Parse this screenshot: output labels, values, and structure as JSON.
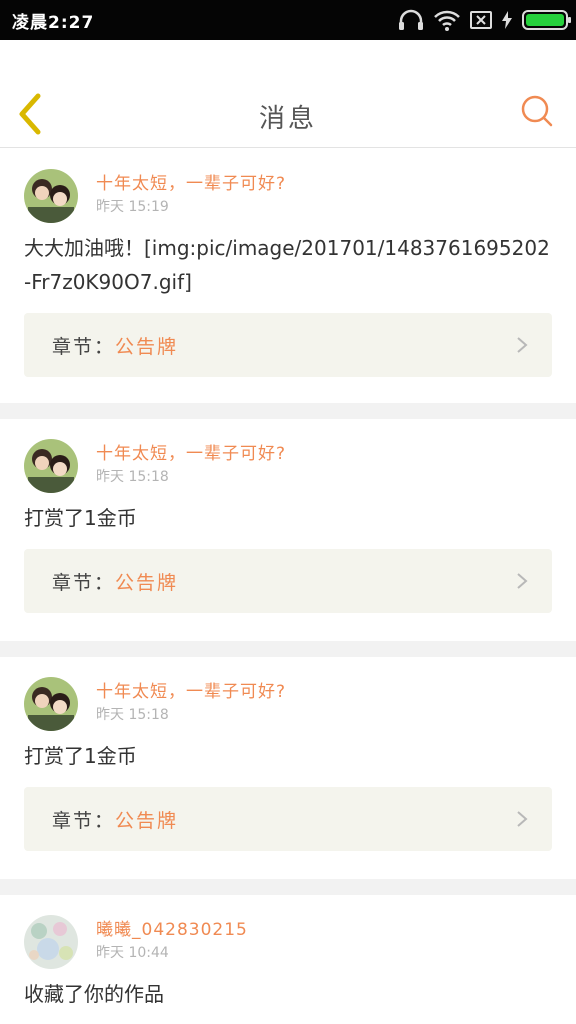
{
  "status_bar": {
    "time": "凌晨2:27",
    "icons": [
      "headphones-icon",
      "wifi-icon",
      "no-sim-icon",
      "charging-icon",
      "battery-icon"
    ],
    "battery_level": 1.0,
    "battery_color": "#26d13c"
  },
  "header": {
    "title": "消息",
    "back_icon": "chevron-left-icon",
    "search_icon": "search-icon",
    "accent_back": "#d9b800",
    "accent_search": "#f08a52"
  },
  "messages": [
    {
      "username": "十年太短，一辈子可好?",
      "time": "昨天 15:19",
      "content": "大大加油哦！[img:pic/image/201701/1483761695202-Fr7z0K90O7.gif]",
      "chapter_label": "章节：",
      "chapter_name": "公告牌"
    },
    {
      "username": "十年太短，一辈子可好?",
      "time": "昨天 15:18",
      "content": "打赏了1金币",
      "chapter_label": "章节：",
      "chapter_name": "公告牌"
    },
    {
      "username": "十年太短，一辈子可好?",
      "time": "昨天 15:18",
      "content": "打赏了1金币",
      "chapter_label": "章节：",
      "chapter_name": "公告牌"
    },
    {
      "username": "曦曦_042830215",
      "time": "昨天 10:44",
      "content": "收藏了你的作品",
      "chapter_label": "",
      "chapter_name": ""
    }
  ],
  "colors": {
    "username": "#f08a52",
    "time": "#b4b4b4",
    "chapter_bg": "#f4f4ed",
    "separator": "#f2f2f2"
  }
}
